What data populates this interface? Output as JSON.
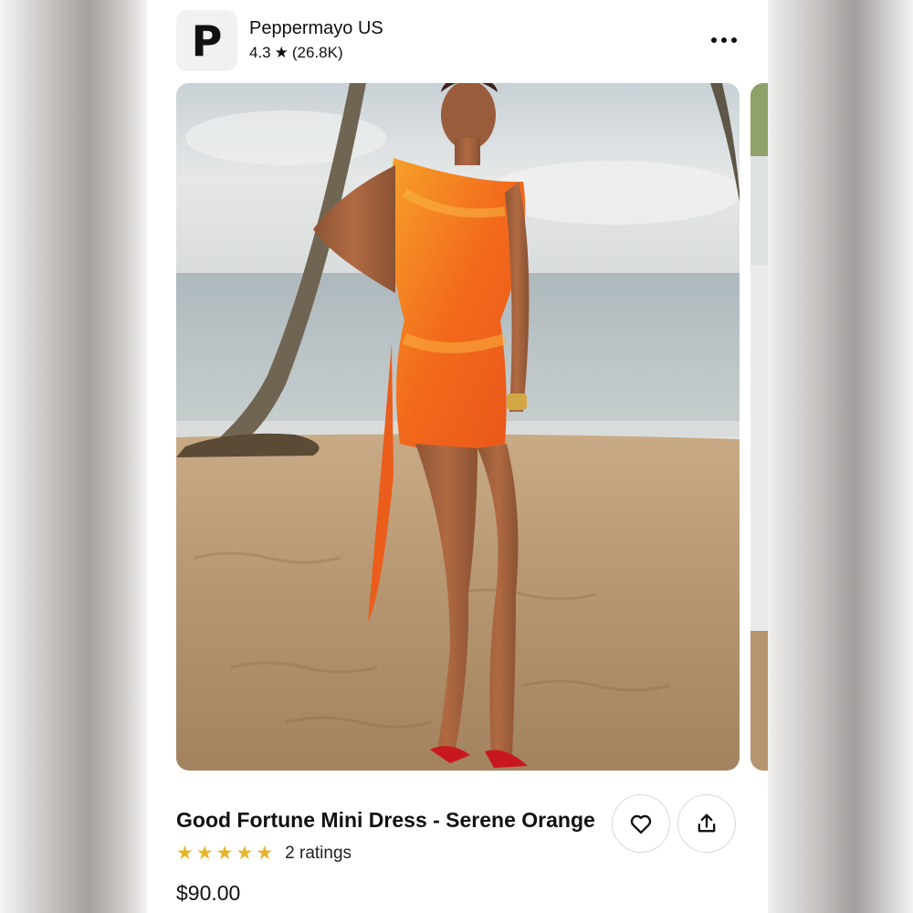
{
  "store": {
    "logo_letter": "P",
    "name": "Peppermayo US",
    "rating": "4.3",
    "star_glyph": "★",
    "review_count": "(26.8K)"
  },
  "product": {
    "title": "Good Fortune Mini Dress - Serene Orange",
    "star_glyph": "★",
    "stars": 5,
    "ratings_label": "2 ratings",
    "price": "$90.00"
  },
  "icons": {
    "more": "more-horizontal-icon",
    "favorite": "heart-icon",
    "share": "share-icon"
  },
  "colors": {
    "star": "#e7b52c",
    "dress": "#f0651c",
    "sand": "#b8966c",
    "sea": "#b9c4c6",
    "sky": "#dfe3e6"
  }
}
